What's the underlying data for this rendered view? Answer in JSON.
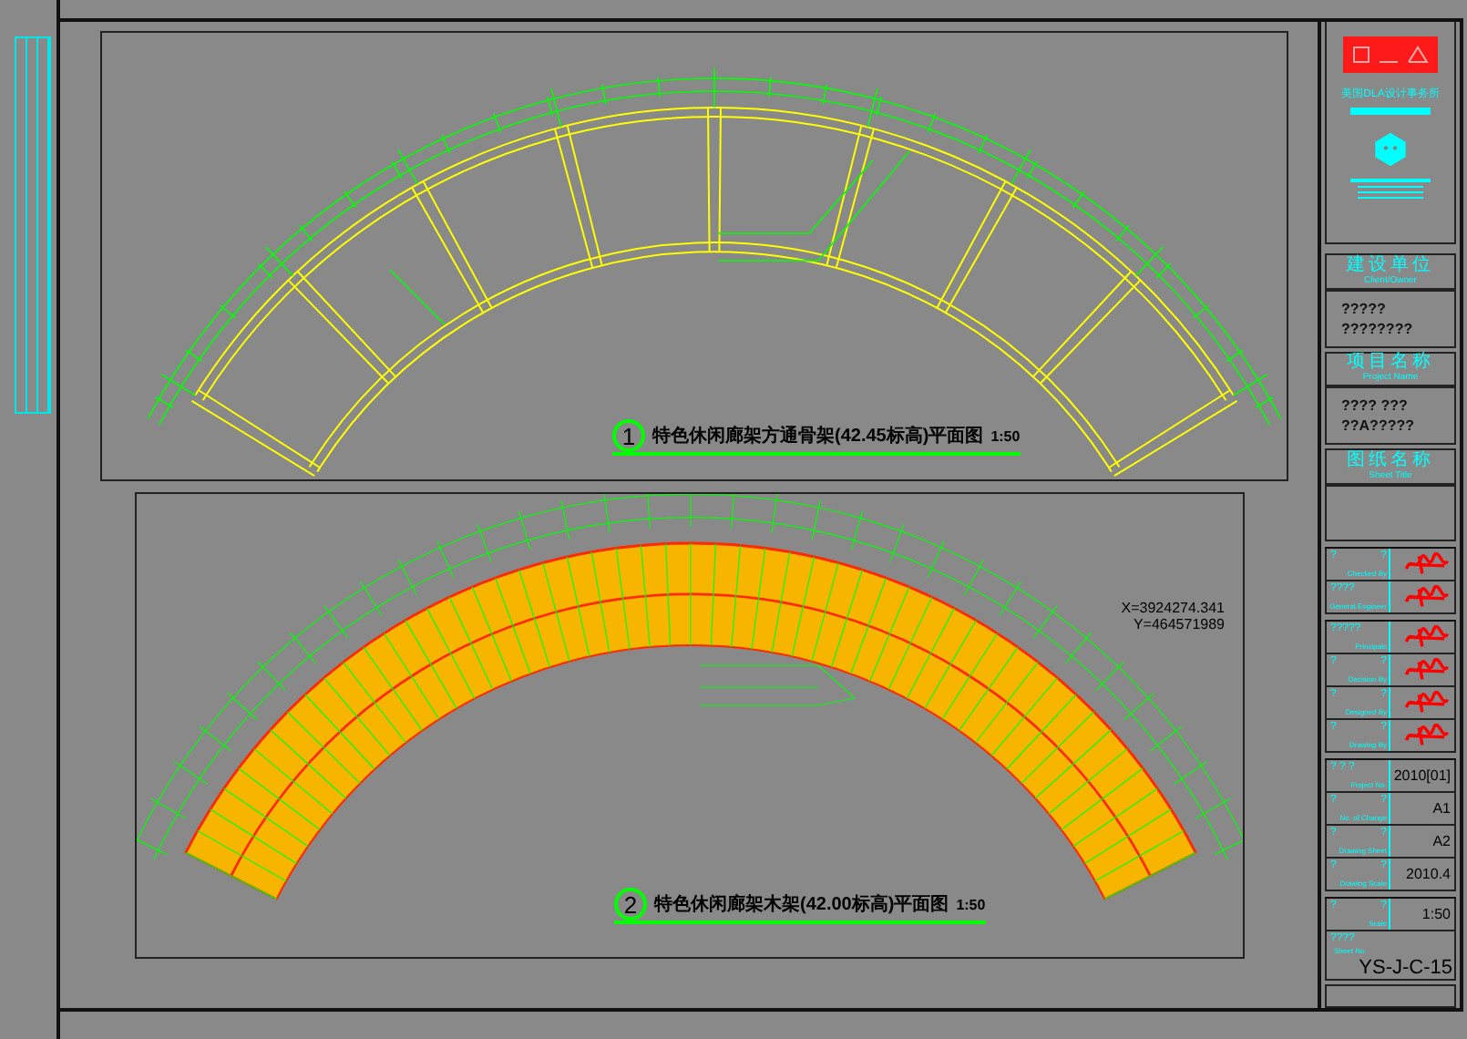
{
  "plans": [
    {
      "kind": "frame",
      "number": "1",
      "title": "特色休闲廊架方通骨架(42.45标高)平面图",
      "scale": "1:50"
    },
    {
      "kind": "timber",
      "number": "2",
      "title": "特色休闲廊架木架(42.00标高)平面图",
      "scale": "1:50"
    }
  ],
  "notes": {
    "lines": [
      "X=3924274.341",
      "Y=464571989"
    ]
  },
  "title_block": {
    "firm": "美国DLA设计事务所",
    "sections": [
      {
        "heading": "建设单位",
        "heading_en": "Client/Owner",
        "lines": [
          "?????",
          "????????"
        ]
      },
      {
        "heading": "项目名称",
        "heading_en": "Project Name",
        "lines": [
          "???? ???",
          "??A?????"
        ]
      },
      {
        "heading": "图纸名称",
        "heading_en": "Sheet Title"
      }
    ],
    "row_groups": [
      [
        {
          "kind": "signature",
          "prefix": "?",
          "suffix": "?",
          "label": "Checked By"
        },
        {
          "kind": "signature",
          "prefix": "????",
          "label": "General Engineer"
        }
      ],
      [
        {
          "kind": "signature",
          "prefix": "?????",
          "label": "Principals"
        },
        {
          "kind": "signature",
          "prefix": "?",
          "suffix": "?",
          "label": "Decision By"
        },
        {
          "kind": "signature",
          "prefix": "?",
          "suffix": "?",
          "label": "Designed By"
        },
        {
          "kind": "signature",
          "prefix": "?",
          "suffix": "?",
          "label": "Drawing By"
        }
      ],
      [
        {
          "kind": "value",
          "prefix": "? ? ?",
          "label": "Project No.",
          "value": "2010[01]"
        },
        {
          "kind": "value",
          "prefix": "?",
          "suffix": "?",
          "label": "No. of Change",
          "value": "A1"
        },
        {
          "kind": "value",
          "prefix": "?",
          "suffix": "?",
          "label": "Drawing Sheet",
          "value": "A2"
        },
        {
          "kind": "value",
          "prefix": "?",
          "suffix": "?",
          "label": "Drawing Scale",
          "value": "2010.4"
        }
      ],
      [
        {
          "kind": "value",
          "prefix": "?",
          "suffix": "?",
          "label": "Scale",
          "value": "1:50"
        },
        {
          "kind": "value",
          "prefix": "????",
          "label": "Sheet No.",
          "value": "YS-J-C-15"
        }
      ]
    ]
  }
}
